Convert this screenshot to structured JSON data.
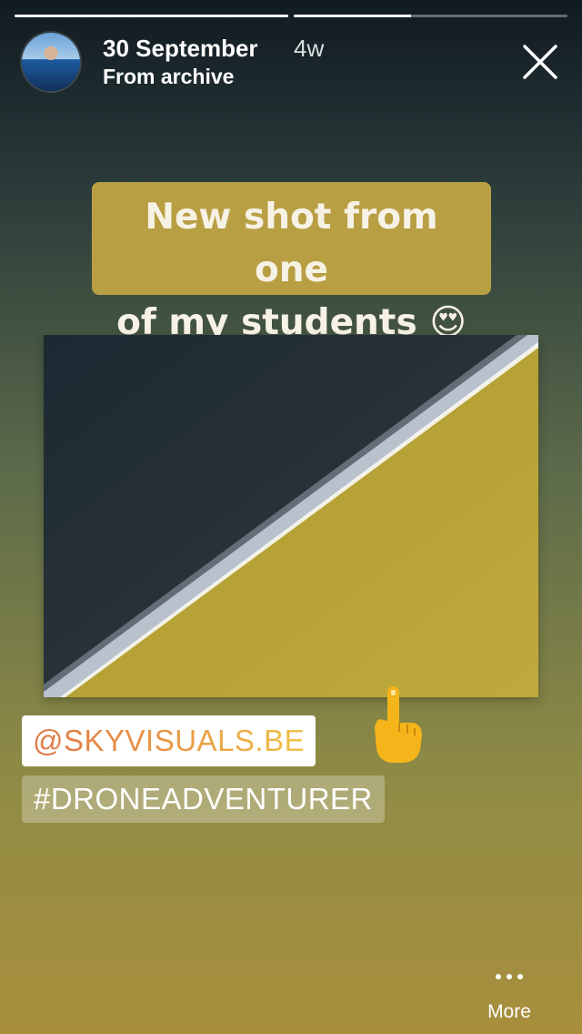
{
  "progress": [
    {
      "fraction": 1.0
    },
    {
      "fraction": 0.43
    }
  ],
  "header": {
    "date": "30 September",
    "age": "4w",
    "subtitle": "From archive",
    "avatar_icon": "profile-avatar",
    "close_icon": "close-icon"
  },
  "story": {
    "caption_line1": "New shot from one",
    "caption_line2": "of my students",
    "caption_emoji": "😍",
    "mention": "@SKYVISUALS.BE",
    "hashtag": "#DRONEADVENTURER",
    "pointer_emoji": "pointing-up-hand-icon"
  },
  "footer": {
    "more_label": "More",
    "more_icon": "more-dots-icon"
  },
  "colors": {
    "caption_bg": "#b99f44",
    "photo_dark": "#233139",
    "photo_yellow": "#bca43a"
  }
}
